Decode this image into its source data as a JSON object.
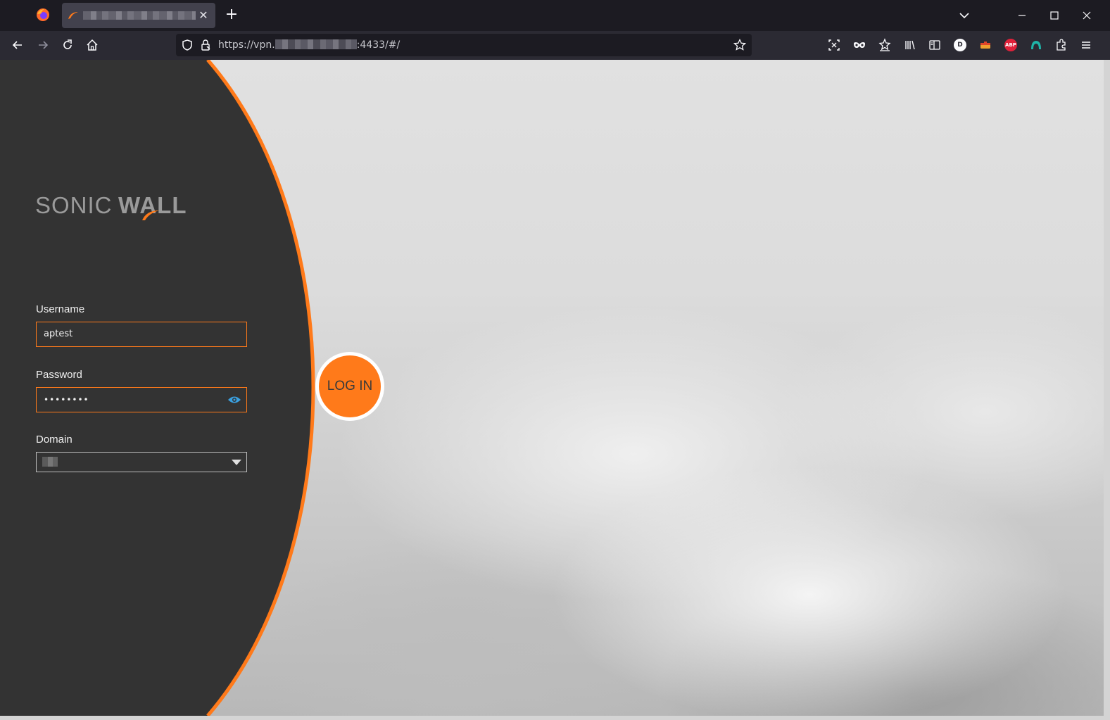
{
  "browser": {
    "tab": {
      "close_glyph": "✕"
    },
    "new_tab_glyph": "+",
    "url": {
      "prefix": "https://vpn.",
      "suffix": ":4433/#/"
    },
    "extensions": [
      {
        "name": "screenshot-icon"
      },
      {
        "name": "mask-icon"
      },
      {
        "name": "bookmarks-star-icon"
      },
      {
        "name": "library-icon"
      },
      {
        "name": "sidebar-icon"
      },
      {
        "name": "d-extension-icon",
        "badge": "D"
      },
      {
        "name": "toolbox-extension-icon"
      },
      {
        "name": "adblock-plus-icon",
        "badge": "ABP"
      },
      {
        "name": "teal-extension-icon"
      },
      {
        "name": "extensions-puzzle-icon"
      },
      {
        "name": "hamburger-menu-icon"
      }
    ]
  },
  "login": {
    "brand": {
      "part1": "SONIC",
      "part2": "WALL"
    },
    "username": {
      "label": "Username",
      "value": "aptest"
    },
    "password": {
      "label": "Password",
      "value": "••••••••"
    },
    "domain": {
      "label": "Domain"
    },
    "submit_label": "LOG IN"
  },
  "colors": {
    "accent": "#ff7a1a",
    "panel": "#333333",
    "chrome_dark": "#1c1b22",
    "chrome_nav": "#2b2a33"
  }
}
